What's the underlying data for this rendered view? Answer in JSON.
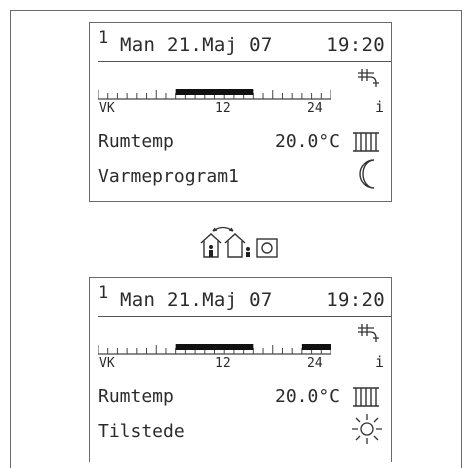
{
  "displays": [
    {
      "program_index": "1",
      "date": "Man 21.Maj 07",
      "time": "19:20",
      "axis": {
        "start": "VK",
        "mid": "12",
        "end": "24"
      },
      "info": "i",
      "room_label": "Rumtemp",
      "room_temp": "20.0°C",
      "mode_label": "Varmeprogram1",
      "mode_icon": "moon-icon",
      "active_bars": [
        [
          8,
          16
        ]
      ]
    },
    {
      "program_index": "1",
      "date": "Man 21.Maj 07",
      "time": "19:20",
      "axis": {
        "start": "VK",
        "mid": "12",
        "end": "24"
      },
      "info": "i",
      "room_label": "Rumtemp",
      "room_temp": "20.0°C",
      "mode_label": "Tilstede",
      "mode_icon": "sun-icon",
      "active_bars": [
        [
          8,
          16
        ],
        [
          21,
          24
        ]
      ]
    }
  ],
  "toggle": {
    "icons": [
      "house-away-icon",
      "house-home-icon",
      "selector-button-icon"
    ]
  }
}
